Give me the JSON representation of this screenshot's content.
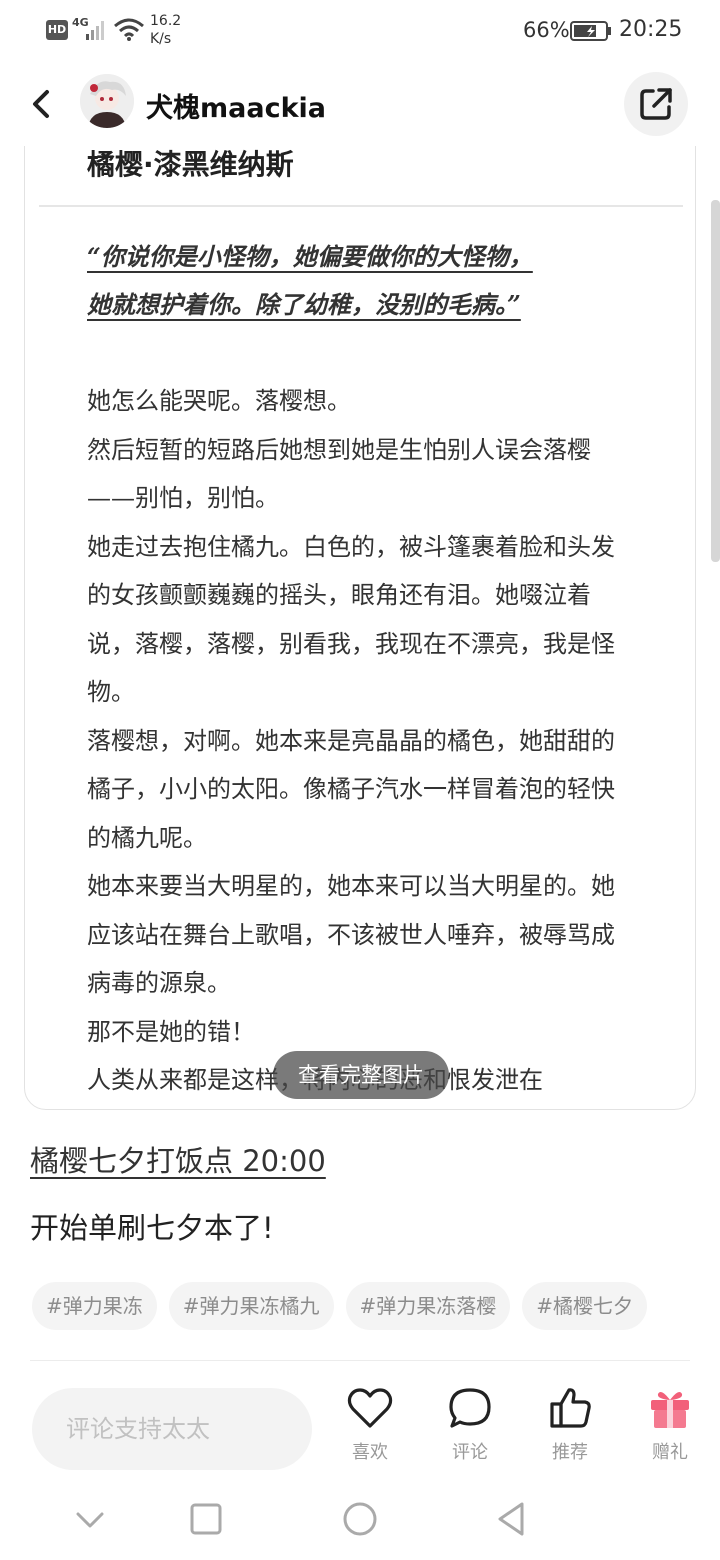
{
  "status_bar": {
    "hd": "HD",
    "network": "4G",
    "speed_value": "16.2",
    "speed_unit": "K/s",
    "battery": "66%",
    "time": "20:25"
  },
  "header": {
    "username": "犬槐maackia"
  },
  "image_card": {
    "title": "橘樱·漆黑维纳斯",
    "quote_line1": "“你说你是小怪物，她偏要做你的大怪物，",
    "quote_line2": "她就想护着你。除了幼稚，没别的毛病。”",
    "paragraphs": [
      "她怎么能哭呢。落樱想。",
      "然后短暂的短路后她想到她是生怕别人误会落樱——别怕，别怕。",
      "她走过去抱住橘九。白色的，被斗篷裹着脸和头发的女孩颤颤巍巍的摇头，眼角还有泪。她啜泣着说，落樱，落樱，别看我，我现在不漂亮，我是怪物。",
      "落樱想，对啊。她本来是亮晶晶的橘色，她甜甜的橘子，小小的太阳。像橘子汽水一样冒着泡的轻快的橘九呢。",
      "她本来要当大明星的，她本来可以当大明星的。她应该站在舞台上歌唱，不该被世人唾弃，被辱骂成病毒的源泉。",
      "那不是她的错！",
      "人类从来都是这样，将内心的恶和恨发泄在"
    ],
    "view_full_label": "查看完整图片"
  },
  "post": {
    "title": "橘樱七夕打饭点 20:00",
    "text": "开始单刷七夕本了!"
  },
  "tags": [
    "#弹力果冻",
    "#弹力果冻橘九",
    "#弹力果冻落樱",
    "#橘樱七夕"
  ],
  "bottom_bar": {
    "comment_placeholder": "评论支持太太",
    "like_label": "喜欢",
    "comment_label": "评论",
    "recommend_label": "推荐",
    "gift_label": "赠礼"
  },
  "colors": {
    "gift_accent": "#f2607a",
    "text_primary": "#222222",
    "text_muted": "#999999"
  }
}
